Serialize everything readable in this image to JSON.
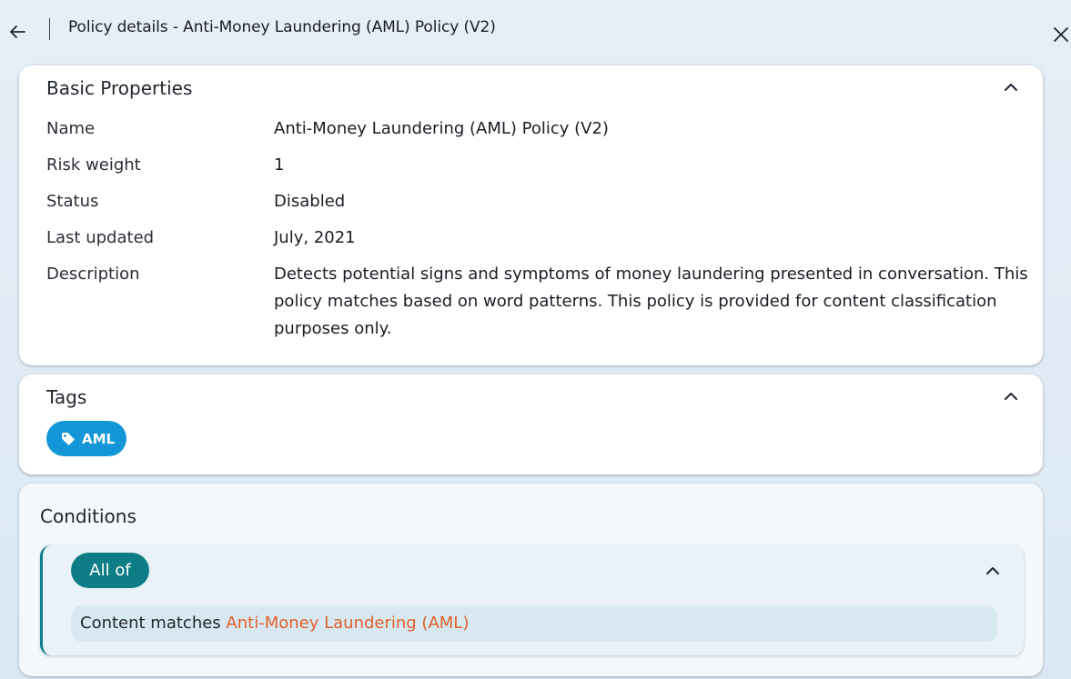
{
  "header": {
    "title": "Policy details - Anti-Money Laundering (AML) Policy (V2)",
    "back_icon": "arrow-left-icon",
    "close_icon": "close-icon"
  },
  "basic_properties": {
    "title": "Basic Properties",
    "rows": [
      {
        "label": "Name",
        "value": "Anti-Money Laundering (AML) Policy (V2)"
      },
      {
        "label": "Risk weight",
        "value": "1"
      },
      {
        "label": "Status",
        "value": "Disabled"
      },
      {
        "label": "Last updated",
        "value": "July, 2021"
      },
      {
        "label": "Description",
        "value": "Detects potential signs and symptoms of money laundering presented in conversation. This policy matches based on word patterns. This policy is provided for content classification purposes only."
      }
    ]
  },
  "tags": {
    "title": "Tags",
    "items": [
      {
        "label": "AML",
        "icon": "tag-icon"
      }
    ]
  },
  "conditions": {
    "title": "Conditions",
    "group_operator": "All of",
    "condition": {
      "prefix": "Content matches",
      "link": "Anti-Money Laundering (AML)"
    }
  },
  "colors": {
    "tag_chip": "#1396d8",
    "group_chip": "#0f7d86",
    "link": "#e0602a"
  }
}
